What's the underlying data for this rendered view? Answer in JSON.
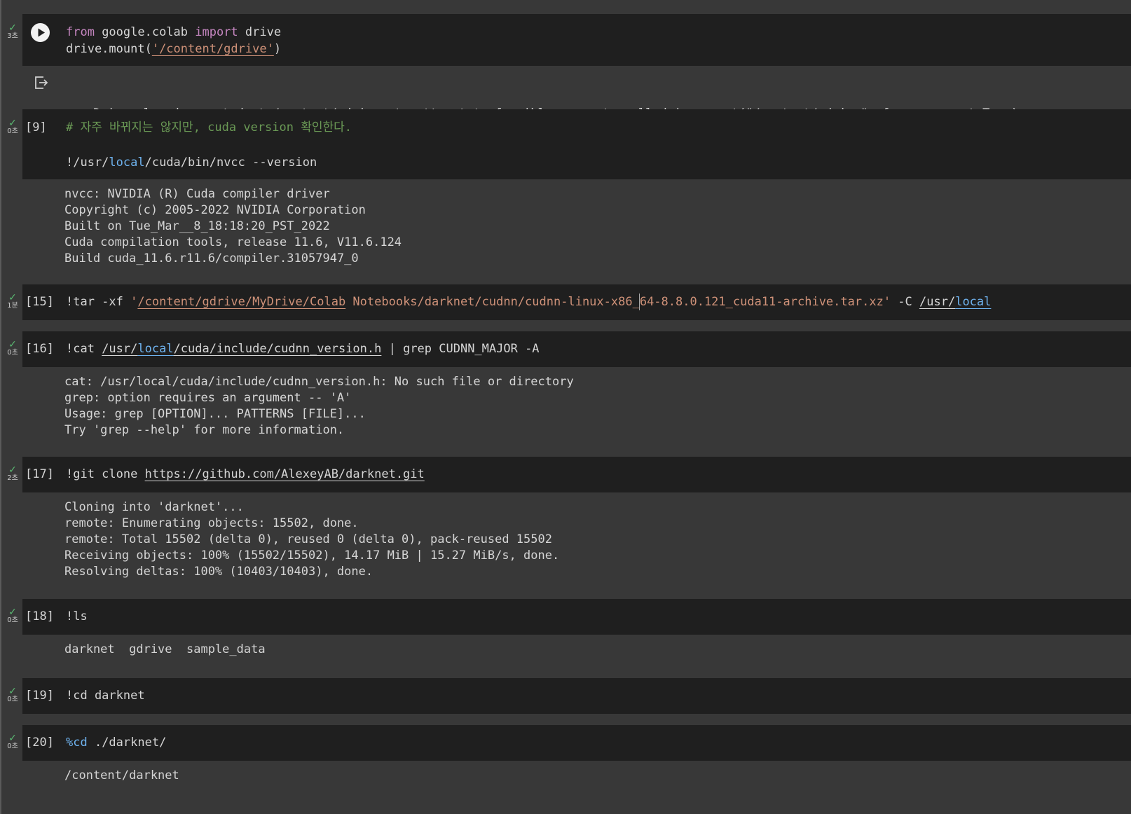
{
  "cells": [
    {
      "id": "mount",
      "status_time": "3초",
      "code": {
        "t1": "from",
        "t2": " google.colab ",
        "t3": "import",
        "t4": " drive",
        "t5": "drive.mount(",
        "t6": "'/content/gdrive'",
        "t7": ")"
      },
      "output": "Drive already mounted at /content/gdrive; to attempt to forcibly remount, call drive.mount(\"/content/gdrive\", force_remount=True)."
    },
    {
      "id": "nvcc",
      "exec_num": "[9]",
      "status_time": "0초",
      "code": {
        "comment": "# 자주 바뀌지는 않지만, cuda version 확인한다.",
        "t1": "!/usr/",
        "t2": "local",
        "t3": "/cuda/bin/nvcc --version"
      },
      "output": "nvcc: NVIDIA (R) Cuda compiler driver\nCopyright (c) 2005-2022 NVIDIA Corporation\nBuilt on Tue_Mar__8_18:18:20_PST_2022\nCuda compilation tools, release 11.6, V11.6.124\nBuild cuda_11.6.r11.6/compiler.31057947_0"
    },
    {
      "id": "tar",
      "exec_num": "[15]",
      "status_time": "1분",
      "code": {
        "t1": "!tar -xf ",
        "t2": "'",
        "t3": "/content/gdrive/MyDrive/Colab",
        "t4": " Notebooks/darknet/cudnn/cudnn-linux-x86_",
        "t5": "64-8.8.0.121_cuda11-archive.tar.xz'",
        "t6": " -C ",
        "t7": "/usr/",
        "t8": "local"
      }
    },
    {
      "id": "cat",
      "exec_num": "[16]",
      "status_time": "0초",
      "code": {
        "t1": "!cat ",
        "t2": "/usr/",
        "t3": "local",
        "t4": "/cuda/include/cudnn_version.h",
        "t5": " | grep CUDNN_MAJOR -A"
      },
      "output": "cat: /usr/local/cuda/include/cudnn_version.h: No such file or directory\ngrep: option requires an argument -- 'A'\nUsage: grep [OPTION]... PATTERNS [FILE]...\nTry 'grep --help' for more information."
    },
    {
      "id": "clone",
      "exec_num": "[17]",
      "status_time": "2초",
      "code": {
        "t1": "!git clone ",
        "t2": "https://github.com/AlexeyAB/darknet.git"
      },
      "output": "Cloning into 'darknet'...\nremote: Enumerating objects: 15502, done.\nremote: Total 15502 (delta 0), reused 0 (delta 0), pack-reused 15502\nReceiving objects: 100% (15502/15502), 14.17 MiB | 15.27 MiB/s, done.\nResolving deltas: 100% (10403/10403), done."
    },
    {
      "id": "ls",
      "exec_num": "[18]",
      "status_time": "0초",
      "code": {
        "t1": "!ls"
      },
      "output": "darknet  gdrive  sample_data"
    },
    {
      "id": "cd",
      "exec_num": "[19]",
      "status_time": "0초",
      "code": {
        "t1": "!cd darknet"
      }
    },
    {
      "id": "magiccd",
      "exec_num": "[20]",
      "status_time": "0초",
      "code": {
        "t1": "%cd",
        "t2": " ./darknet/"
      },
      "output": "/content/darknet"
    }
  ]
}
